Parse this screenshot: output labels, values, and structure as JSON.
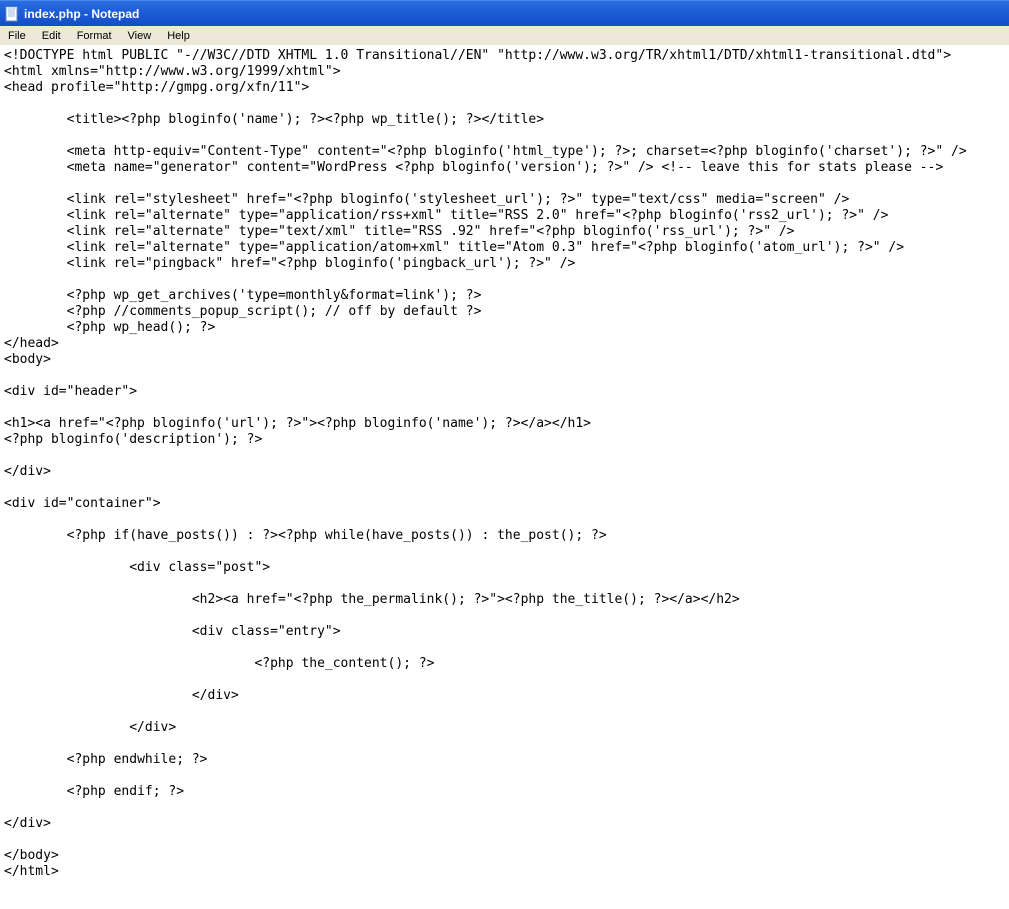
{
  "window": {
    "title": "index.php - Notepad"
  },
  "menu": {
    "items": [
      "File",
      "Edit",
      "Format",
      "View",
      "Help"
    ]
  },
  "editor": {
    "content": "<!DOCTYPE html PUBLIC \"-//W3C//DTD XHTML 1.0 Transitional//EN\" \"http://www.w3.org/TR/xhtml1/DTD/xhtml1-transitional.dtd\">\n<html xmlns=\"http://www.w3.org/1999/xhtml\">\n<head profile=\"http://gmpg.org/xfn/11\">\n\n\t<title><?php bloginfo('name'); ?><?php wp_title(); ?></title>\n\n\t<meta http-equiv=\"Content-Type\" content=\"<?php bloginfo('html_type'); ?>; charset=<?php bloginfo('charset'); ?>\" />\t\n\t<meta name=\"generator\" content=\"WordPress <?php bloginfo('version'); ?>\" /> <!-- leave this for stats please -->\n\n\t<link rel=\"stylesheet\" href=\"<?php bloginfo('stylesheet_url'); ?>\" type=\"text/css\" media=\"screen\" />\n\t<link rel=\"alternate\" type=\"application/rss+xml\" title=\"RSS 2.0\" href=\"<?php bloginfo('rss2_url'); ?>\" />\n\t<link rel=\"alternate\" type=\"text/xml\" title=\"RSS .92\" href=\"<?php bloginfo('rss_url'); ?>\" />\n\t<link rel=\"alternate\" type=\"application/atom+xml\" title=\"Atom 0.3\" href=\"<?php bloginfo('atom_url'); ?>\" />\n\t<link rel=\"pingback\" href=\"<?php bloginfo('pingback_url'); ?>\" />\n\n\t<?php wp_get_archives('type=monthly&format=link'); ?>\n\t<?php //comments_popup_script(); // off by default ?>\n\t<?php wp_head(); ?>\n</head>\n<body>\n\n<div id=\"header\">\n\n<h1><a href=\"<?php bloginfo('url'); ?>\"><?php bloginfo('name'); ?></a></h1>\n<?php bloginfo('description'); ?>\n\n</div>\n\n<div id=\"container\">\n\n\t<?php if(have_posts()) : ?><?php while(have_posts()) : the_post(); ?>\n\n\t\t<div class=\"post\">\n\n\t\t\t<h2><a href=\"<?php the_permalink(); ?>\"><?php the_title(); ?></a></h2>\n\n\t\t\t<div class=\"entry\">\n\n\t\t\t\t<?php the_content(); ?>\n\n\t\t\t</div>\n\n\t\t</div>\n\n\t<?php endwhile; ?>\n\n\t<?php endif; ?>\n\n</div>\n\n</body>\n</html>"
  }
}
